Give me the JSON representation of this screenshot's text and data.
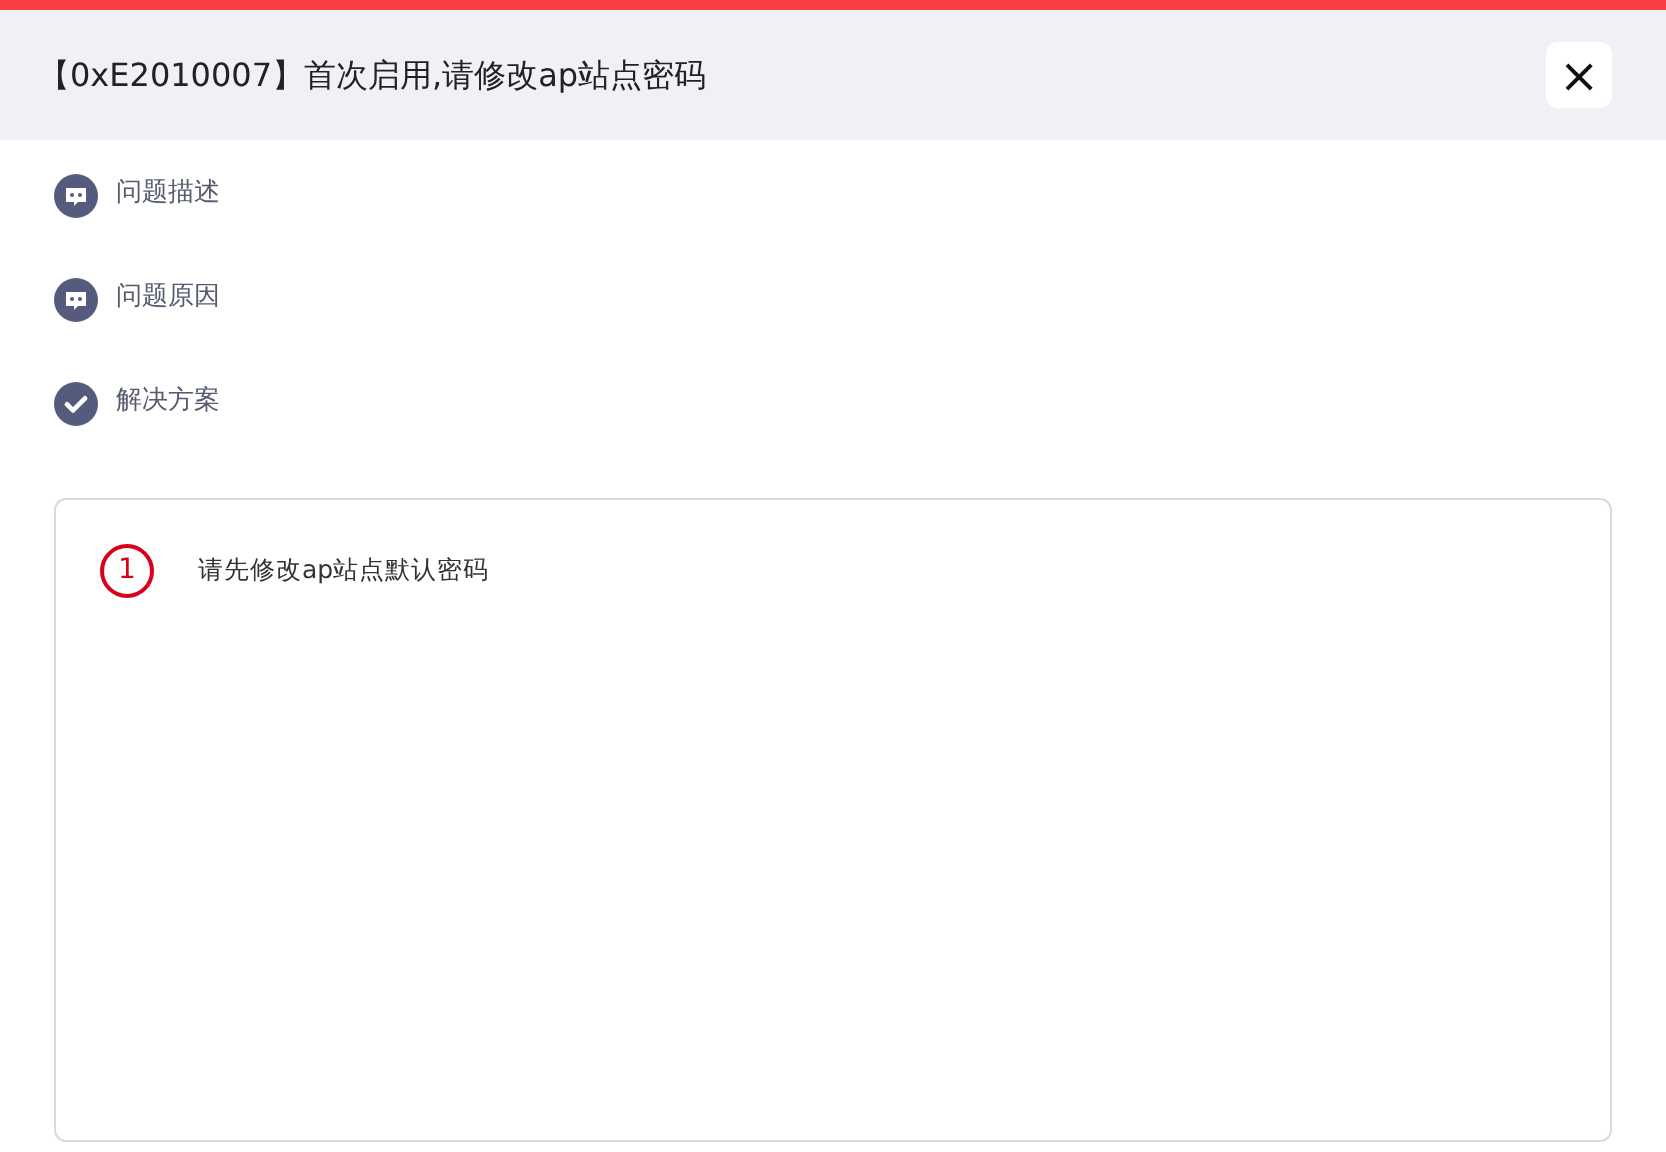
{
  "dialog": {
    "title": "【0xE2010007】首次启用,请修改ap站点密码",
    "close": "×"
  },
  "sections": [
    {
      "kind": "chat",
      "label": "问题描述"
    },
    {
      "kind": "chat",
      "label": "问题原因"
    },
    {
      "kind": "check",
      "label": "解决方案"
    }
  ],
  "solution_steps": [
    {
      "number": "1",
      "text": "请先修改ap站点默认密码"
    }
  ]
}
